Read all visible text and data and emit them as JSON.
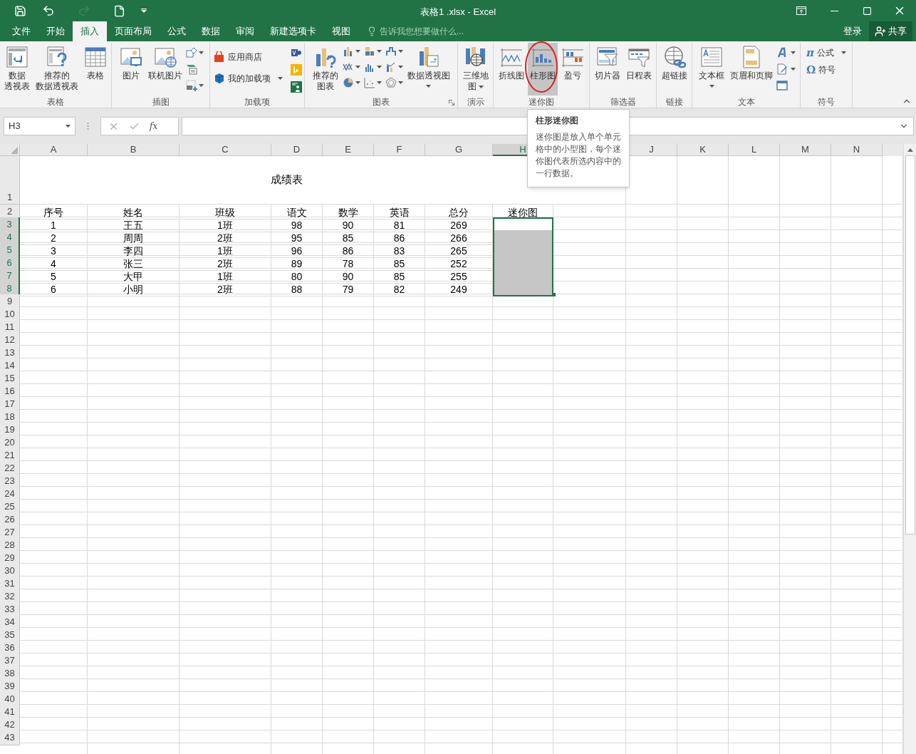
{
  "title_bar": {
    "title": "表格1 .xlsx - Excel",
    "quick_access": [
      {
        "kind": "save",
        "disabled": false
      },
      {
        "kind": "undo",
        "disabled": false
      },
      {
        "kind": "redo",
        "disabled": true
      },
      {
        "kind": "new",
        "disabled": false
      },
      {
        "kind": "customize",
        "disabled": false
      }
    ]
  },
  "tabs": [
    {
      "label": "文件",
      "selected": false
    },
    {
      "label": "开始",
      "selected": false
    },
    {
      "label": "插入",
      "selected": true
    },
    {
      "label": "页面布局",
      "selected": false
    },
    {
      "label": "公式",
      "selected": false
    },
    {
      "label": "数据",
      "selected": false
    },
    {
      "label": "审阅",
      "selected": false
    },
    {
      "label": "新建选项卡",
      "selected": false
    },
    {
      "label": "视图",
      "selected": false
    }
  ],
  "tell_me": {
    "placeholder": "告诉我您想要做什么..."
  },
  "sign_in": "登录",
  "share": "共享",
  "ribbon": {
    "groups": [
      {
        "label": "表格",
        "buttons": [
          {
            "lines": [
              "数据",
              "透视表"
            ]
          },
          {
            "lines": [
              "推荐的",
              "数据透视表"
            ]
          },
          {
            "lines": [
              "表格"
            ]
          }
        ]
      },
      {
        "label": "插图",
        "buttons": [
          {
            "lines": [
              "图片"
            ]
          },
          {
            "lines": [
              "联机图片"
            ]
          }
        ]
      },
      {
        "label": "加载项",
        "buttons": [
          {
            "lines": [
              "应用商店"
            ]
          },
          {
            "lines": [
              "我的加载项"
            ],
            "dropdown": true
          }
        ]
      },
      {
        "label": "图表",
        "buttons": [
          {
            "lines": [
              "推荐的",
              "图表"
            ]
          },
          {
            "lines": [
              "数据透视图"
            ],
            "dropdown": true
          }
        ]
      },
      {
        "label": "演示",
        "buttons": [
          {
            "lines": [
              "三维地",
              "图"
            ],
            "dropdown": true
          }
        ]
      },
      {
        "label": "迷你图",
        "buttons": [
          {
            "lines": [
              "折线图"
            ],
            "hovered": false
          },
          {
            "lines": [
              "柱形图"
            ],
            "hovered": true
          },
          {
            "lines": [
              "盈亏"
            ],
            "hovered": false
          }
        ]
      },
      {
        "label": "筛选器",
        "buttons": [
          {
            "lines": [
              "切片器"
            ]
          },
          {
            "lines": [
              "日程表"
            ]
          }
        ]
      },
      {
        "label": "链接",
        "buttons": [
          {
            "lines": [
              "超链接"
            ]
          }
        ]
      },
      {
        "label": "文本",
        "buttons": [
          {
            "lines": [
              "文本框"
            ],
            "dropdown": true
          },
          {
            "lines": [
              "页眉和页脚"
            ]
          }
        ]
      },
      {
        "label": "符号",
        "buttons": [
          {
            "lines": [
              "公式"
            ],
            "dropdown": true,
            "icon_char": "π"
          },
          {
            "lines": [
              "符号"
            ],
            "icon_char": "Ω"
          }
        ]
      }
    ]
  },
  "tooltip": {
    "title": "柱形迷你图",
    "text": "迷你图是放入单个单元格中的小型图，每个迷你图代表所选内容中的一行数据。"
  },
  "name_box": "H3",
  "function_button": "fx",
  "sheet": {
    "column_headers": [
      {
        "label": "A",
        "selected": false
      },
      {
        "label": "B",
        "selected": false
      },
      {
        "label": "C",
        "selected": false
      },
      {
        "label": "D",
        "selected": false
      },
      {
        "label": "E",
        "selected": false
      },
      {
        "label": "F",
        "selected": false
      },
      {
        "label": "G",
        "selected": false
      },
      {
        "label": "H",
        "selected": true
      },
      {
        "label": "J",
        "selected": false
      },
      {
        "label": "K",
        "selected": false
      },
      {
        "label": "L",
        "selected": false
      },
      {
        "label": "M",
        "selected": false
      },
      {
        "label": "N",
        "selected": false
      }
    ],
    "title": "成绩表",
    "header_row": [
      "序号",
      "姓名",
      "班级",
      "语文",
      "数学",
      "英语",
      "总分",
      "迷你图"
    ],
    "rows": [
      {
        "cells": [
          "1",
          "王五",
          "1班",
          "98",
          "90",
          "81",
          "269"
        ],
        "sparkline_selected": true,
        "sparkline_active": true
      },
      {
        "cells": [
          "2",
          "周周",
          "2班",
          "95",
          "85",
          "86",
          "266"
        ],
        "sparkline_selected": true,
        "sparkline_active": false
      },
      {
        "cells": [
          "3",
          "李四",
          "1班",
          "96",
          "86",
          "83",
          "265"
        ],
        "sparkline_selected": true,
        "sparkline_active": false
      },
      {
        "cells": [
          "4",
          "张三",
          "2班",
          "89",
          "78",
          "85",
          "252"
        ],
        "sparkline_selected": true,
        "sparkline_active": false
      },
      {
        "cells": [
          "5",
          "大甲",
          "1班",
          "80",
          "90",
          "85",
          "255"
        ],
        "sparkline_selected": true,
        "sparkline_active": false
      },
      {
        "cells": [
          "6",
          "小明",
          "2班",
          "88",
          "79",
          "82",
          "249"
        ],
        "sparkline_selected": true,
        "sparkline_active": false
      }
    ],
    "row_numbers": [
      "1",
      "2",
      "3",
      "4",
      "5",
      "6",
      "7",
      "8",
      "9",
      "10",
      "11",
      "12",
      "13",
      "14",
      "15",
      "16",
      "17",
      "18",
      "19",
      "20",
      "21",
      "22",
      "23",
      "24",
      "25",
      "26",
      "27",
      "28",
      "29",
      "30",
      "31",
      "32",
      "33",
      "34",
      "35",
      "36",
      "37",
      "38",
      "39",
      "40",
      "41",
      "42",
      "43"
    ]
  }
}
